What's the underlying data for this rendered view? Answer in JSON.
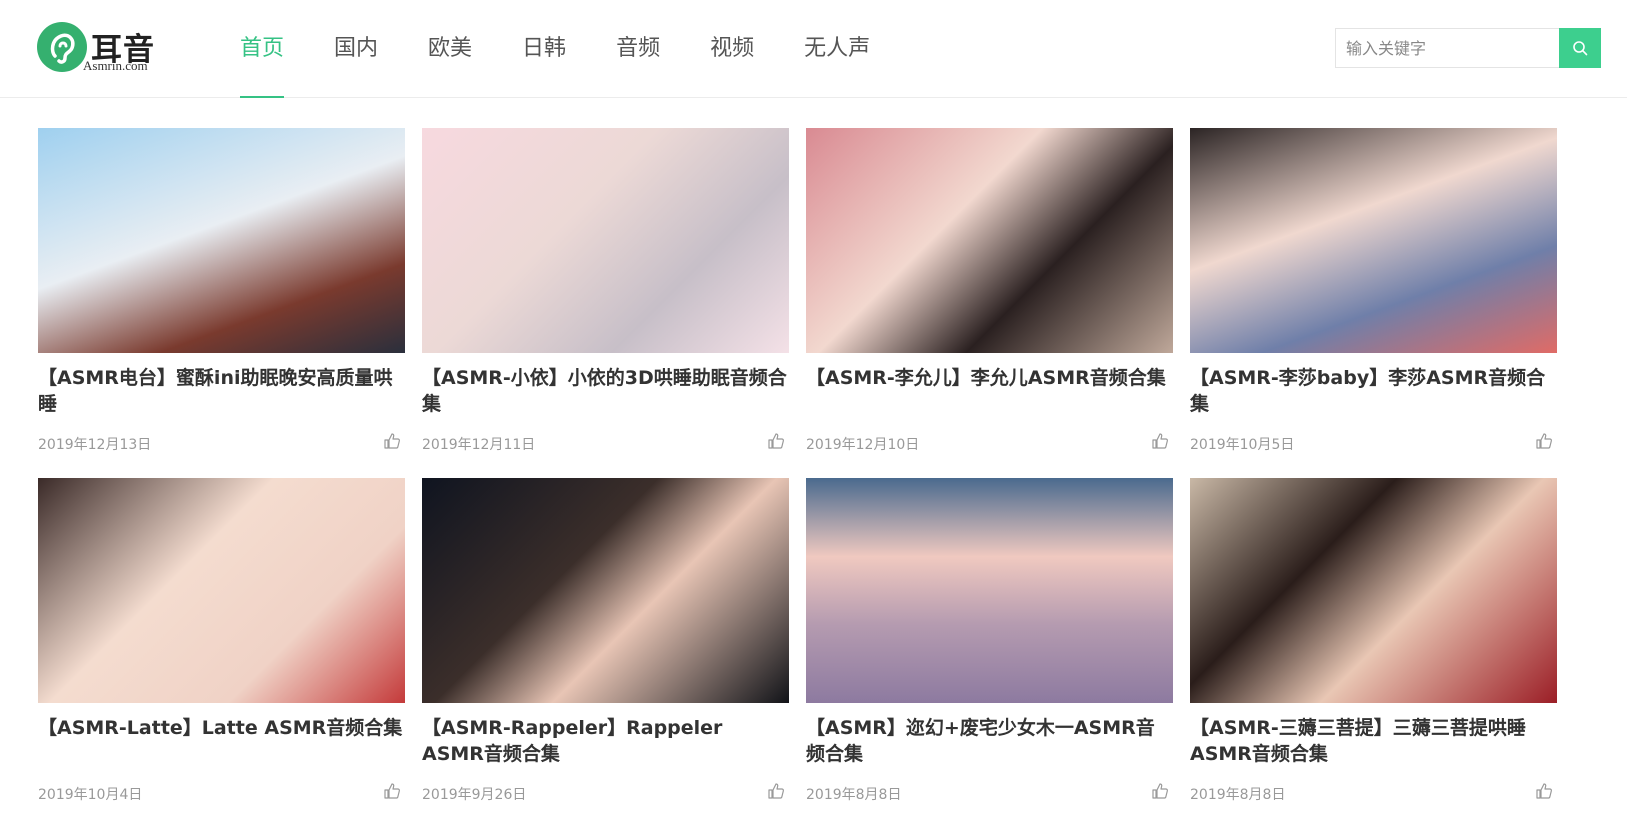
{
  "site": {
    "logo_text": "耳音",
    "logo_sub": "Asmrin.com",
    "brand_color": "#35c284"
  },
  "nav": [
    {
      "label": "首页",
      "active": true
    },
    {
      "label": "国内"
    },
    {
      "label": "欧美"
    },
    {
      "label": "日韩"
    },
    {
      "label": "音频"
    },
    {
      "label": "视频"
    },
    {
      "label": "无人声"
    }
  ],
  "search": {
    "placeholder": "输入关键字",
    "icon": "search-icon"
  },
  "cards": [
    {
      "title": "【ASMR电台】蜜酥ini助眠晚安高质量哄睡",
      "date": "2019年12月13日",
      "thumb_bg": "linear-gradient(160deg,#9fd0ef 0%,#e9eef3 45%,#7a3a2e 75%,#2a2f3c 100%)"
    },
    {
      "title": "【ASMR-小依】小依的3D哄睡助眠音频合集",
      "date": "2019年12月11日",
      "thumb_bg": "linear-gradient(135deg,#f7d9df 0%,#ecd9d6 40%,#c7bfc8 70%,#f4e1e7 100%)"
    },
    {
      "title": "【ASMR-李允儿】李允儿ASMR音频合集",
      "date": "2019年12月10日",
      "thumb_bg": "linear-gradient(135deg,#d98a92 0%,#f2d8cf 40%,#2a2020 65%,#bfa89a 100%)"
    },
    {
      "title": "【ASMR-李莎baby】李莎ASMR音频合集",
      "date": "2019年10月5日",
      "thumb_bg": "linear-gradient(160deg,#2b2424 0%,#f0d8cf 40%,#6f7fa9 70%,#e06b66 100%)"
    },
    {
      "title": "【ASMR-Latte】Latte ASMR音频合集",
      "date": "2019年10月4日",
      "thumb_bg": "linear-gradient(135deg,#3a2a28 0%,#f4dccf 40%,#f0d2c6 70%,#c43a3a 100%)"
    },
    {
      "title": "【ASMR-Rappeler】Rappeler ASMR音频合集",
      "date": "2019年9月26日",
      "thumb_bg": "linear-gradient(135deg,#0f1420 0%,#3b2e2a 40%,#e8c5b5 60%,#111318 100%)"
    },
    {
      "title": "【ASMR】迩幻+废宅少女木一ASMR音频合集",
      "date": "2019年8月8日",
      "thumb_bg": "linear-gradient(180deg,#4a6a8e 0%,#f0c9c0 35%,#b59bb0 65%,#8d7aa0 100%)"
    },
    {
      "title": "【ASMR-三薅三菩提】三薅三菩提哄睡ASMR音频合集",
      "date": "2019年8月8日",
      "thumb_bg": "linear-gradient(135deg,#c9b8a6 0%,#2a1d1a 35%,#e9c7b4 60%,#9b1e26 100%)"
    }
  ]
}
